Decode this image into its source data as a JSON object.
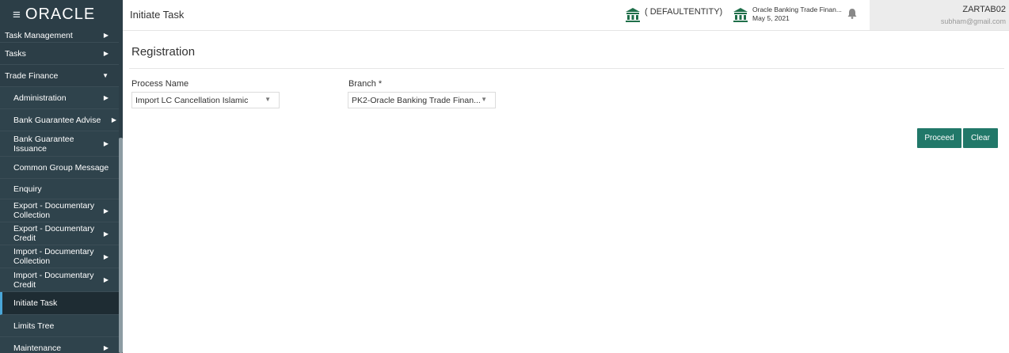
{
  "brand": {
    "logo": "ORACLE",
    "menu_icon": "hamburger-icon"
  },
  "header": {
    "title": "Initiate Task",
    "entity": "( DEFAULTENTITY)",
    "bank_name": "Oracle Banking Trade Finan...",
    "date": "May 5, 2021",
    "user_name": "ZARTAB02",
    "user_email": "subham@gmail.com"
  },
  "sidebar": {
    "items": [
      {
        "label": "Task Management"
      },
      {
        "label": "Tasks"
      },
      {
        "label": "Trade Finance"
      },
      {
        "label": "Administration"
      },
      {
        "label": "Bank Guarantee Advise"
      },
      {
        "label": "Bank Guarantee Issuance"
      },
      {
        "label": "Common Group Message"
      },
      {
        "label": "Enquiry"
      },
      {
        "label": "Export - Documentary Collection"
      },
      {
        "label": "Export - Documentary Credit"
      },
      {
        "label": "Import - Documentary Collection"
      },
      {
        "label": "Import - Documentary Credit"
      },
      {
        "label": "Initiate Task"
      },
      {
        "label": "Limits Tree"
      },
      {
        "label": "Maintenance"
      }
    ]
  },
  "registration": {
    "title": "Registration",
    "process_label": "Process Name",
    "process_value": "Import LC Cancellation Islamic",
    "branch_label": "Branch",
    "branch_required": "*",
    "branch_value": "PK2-Oracle Banking Trade Finan..."
  },
  "actions": {
    "proceed": "Proceed",
    "clear": "Clear"
  },
  "colors": {
    "sidebar": "#2c3e47",
    "accent": "#217869",
    "active_marker": "#4aa6d8",
    "bank_icon": "#1f6f4a"
  }
}
